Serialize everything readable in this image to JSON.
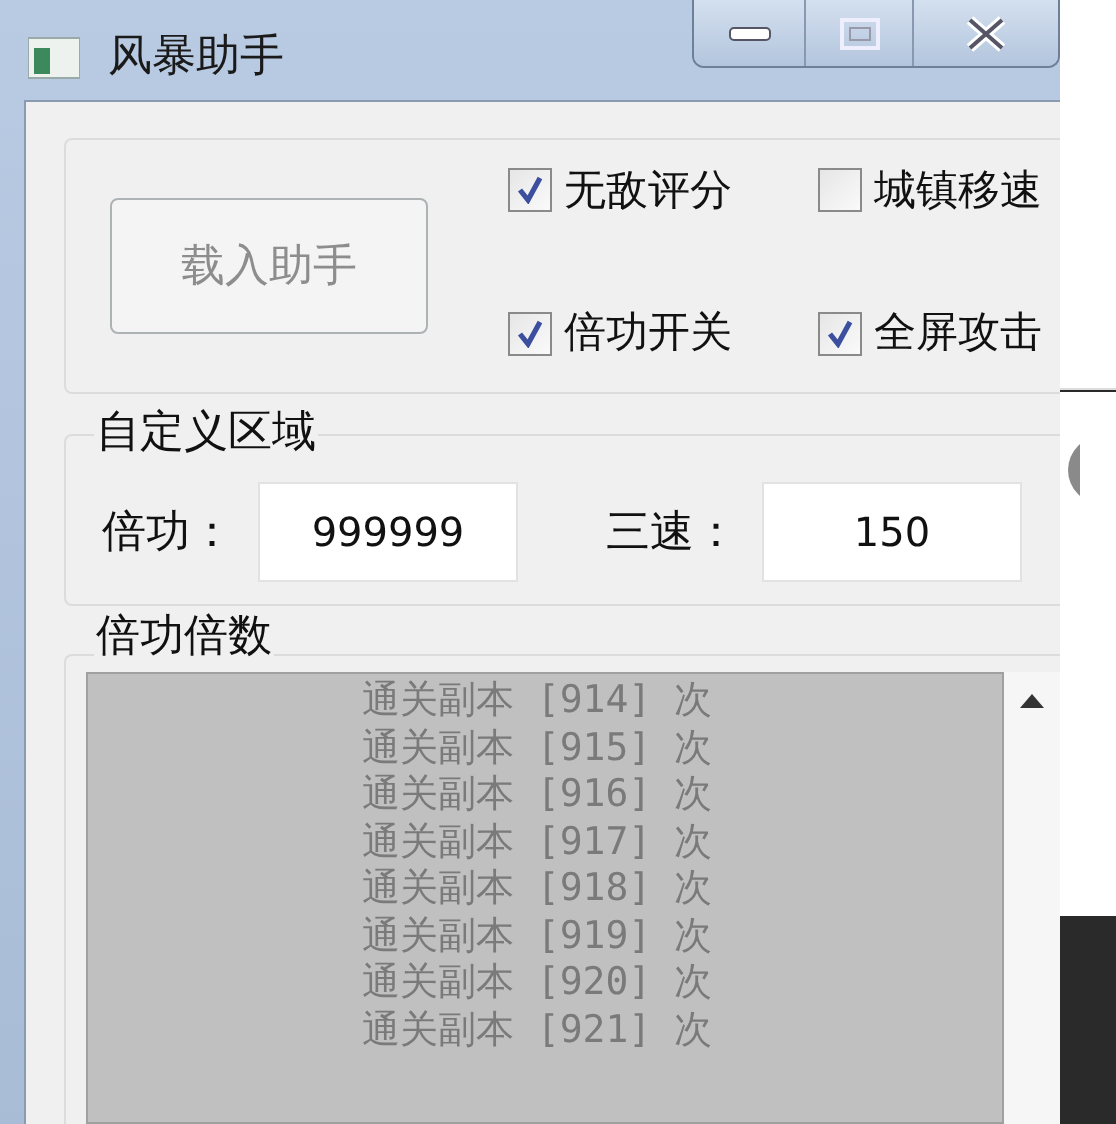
{
  "window": {
    "title": "风暴助手"
  },
  "load_button": {
    "label": "载入助手",
    "disabled": true
  },
  "checkboxes": [
    {
      "label": "无敌评分",
      "checked": true
    },
    {
      "label": "城镇移速",
      "checked": false
    },
    {
      "label": "倍功开关",
      "checked": true
    },
    {
      "label": "全屏攻击",
      "checked": true
    }
  ],
  "custom_area": {
    "title": "自定义区域",
    "fields": [
      {
        "label": "倍功：",
        "value": "999999"
      },
      {
        "label": "三速：",
        "value": "150"
      }
    ]
  },
  "multiplier": {
    "title": "倍功倍数",
    "items": [
      "通关副本 [914] 次",
      "通关副本 [915] 次",
      "通关副本 [916] 次",
      "通关副本 [917] 次",
      "通关副本 [918] 次",
      "通关副本 [919] 次",
      "通关副本 [920] 次",
      "通关副本 [921] 次"
    ]
  }
}
